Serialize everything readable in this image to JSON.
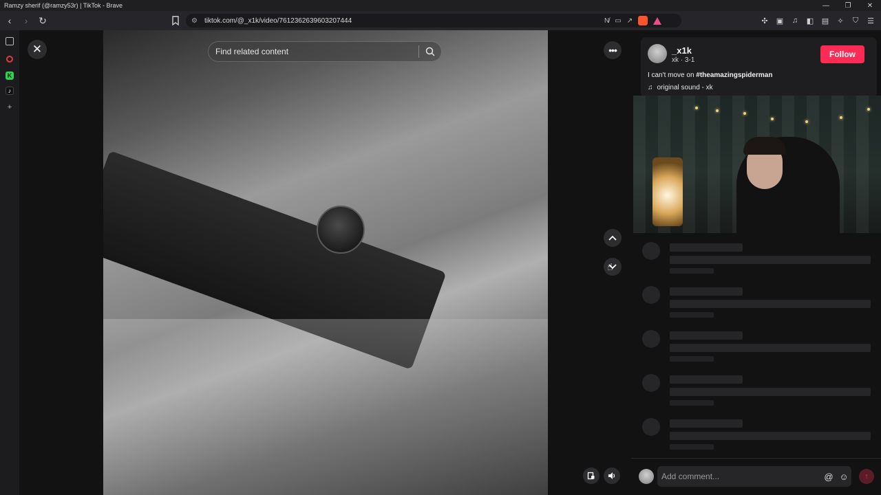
{
  "window": {
    "title": "Ramzy sherif (@ramzy53r) | TikTok - Brave",
    "minimize": "—",
    "restore": "❐",
    "close": "✕"
  },
  "browser": {
    "back_icon": "‹",
    "forward_icon": "›",
    "reload_icon": "↻",
    "url": "tiktok.com/@_x1k/video/7612362639603207444",
    "url_icons": [
      "no-tracking-icon",
      "cast-icon",
      "share-icon",
      "brave-shields-icon",
      "brave-rewards-icon"
    ],
    "right_icons": [
      "extensions-icon",
      "screenshot-icon",
      "media-icon",
      "sidebar-icon",
      "wallet-icon",
      "leo-ai-icon",
      "vpn-icon",
      "menu-icon"
    ]
  },
  "sidebar": {
    "items": [
      "panel-icon",
      "record-icon",
      "kick-icon",
      "tiktok-icon",
      "add-icon"
    ],
    "add_label": "+"
  },
  "video": {
    "search_placeholder": "Find related content",
    "close_label": "✕",
    "more_label": "•••"
  },
  "author": {
    "username": "_x1k",
    "subtitle": "xk · 3-1",
    "follow_label": "Follow",
    "caption_text": "I can't move on ",
    "caption_tag": "#theamazingspiderman",
    "sound": "original sound - xk"
  },
  "comment": {
    "placeholder": "Add comment...",
    "mention_icon": "@",
    "emoji_icon": "☺",
    "send_icon": "↑"
  },
  "skeleton_rows": 5,
  "colors": {
    "follow": "#fe2c55",
    "background": "#121212",
    "panel_card": "#1e1e20"
  }
}
